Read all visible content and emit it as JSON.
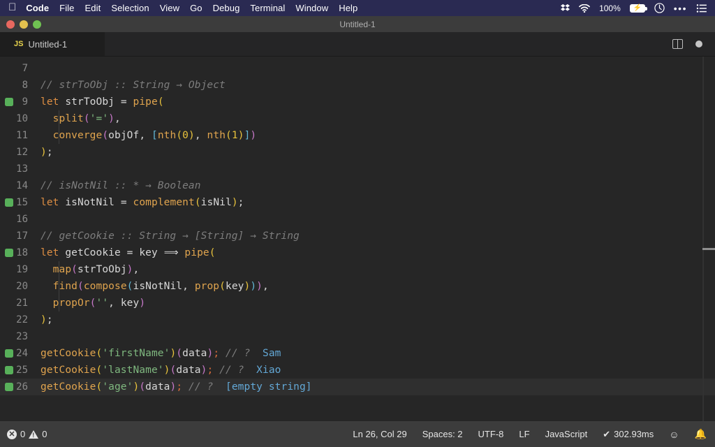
{
  "menubar": {
    "apple_icon": "apple-logo",
    "items": [
      {
        "label": "Code",
        "bold": true
      },
      {
        "label": "File",
        "bold": false
      },
      {
        "label": "Edit",
        "bold": false
      },
      {
        "label": "Selection",
        "bold": false
      },
      {
        "label": "View",
        "bold": false
      },
      {
        "label": "Go",
        "bold": false
      },
      {
        "label": "Debug",
        "bold": false
      },
      {
        "label": "Terminal",
        "bold": false
      },
      {
        "label": "Window",
        "bold": false
      },
      {
        "label": "Help",
        "bold": false
      }
    ],
    "status": {
      "dropbox_icon": "dropbox-icon",
      "wifi_icon": "wifi-icon",
      "battery_percent": "100%",
      "battery_icon": "battery-charging-icon",
      "clock_icon": "clock-icon",
      "more_icon": "ellipsis-icon",
      "list_icon": "control-center-icon"
    },
    "background": "#2a2a52"
  },
  "window": {
    "title": "Untitled-1",
    "traffic_lights": [
      "close",
      "minimize",
      "zoom"
    ],
    "colors": {
      "close": "#e8685f",
      "minimize": "#e3c14e",
      "zoom": "#70c352"
    }
  },
  "tabbar": {
    "tab": {
      "language_badge": "JS",
      "name": "Untitled-1"
    },
    "actions": {
      "split_editor_icon": "split-editor-icon",
      "unsaved_dot": "unsaved-indicator"
    }
  },
  "editor": {
    "first_visible_line": 7,
    "current_line": 26,
    "lines": [
      {
        "num": 7,
        "breakpoint": false,
        "indent": false,
        "tokens": []
      },
      {
        "num": 8,
        "breakpoint": false,
        "indent": false,
        "tokens": [
          {
            "t": "// strToObj :: String → Object",
            "c": "c-comment"
          }
        ]
      },
      {
        "num": 9,
        "breakpoint": true,
        "indent": false,
        "tokens": [
          {
            "t": "let",
            "c": "c-kw"
          },
          {
            "t": " ",
            "c": "c-plain"
          },
          {
            "t": "strToObj",
            "c": "c-var"
          },
          {
            "t": " ",
            "c": "c-plain"
          },
          {
            "t": "=",
            "c": "c-op"
          },
          {
            "t": " ",
            "c": "c-plain"
          },
          {
            "t": "pipe",
            "c": "c-fn"
          },
          {
            "t": "(",
            "c": "c-paren1"
          }
        ]
      },
      {
        "num": 10,
        "breakpoint": false,
        "indent": true,
        "tokens": [
          {
            "t": "  ",
            "c": "c-plain"
          },
          {
            "t": "split",
            "c": "c-fn"
          },
          {
            "t": "(",
            "c": "c-paren2"
          },
          {
            "t": "'='",
            "c": "c-str"
          },
          {
            "t": ")",
            "c": "c-paren2"
          },
          {
            "t": ",",
            "c": "c-plain"
          }
        ]
      },
      {
        "num": 11,
        "breakpoint": false,
        "indent": true,
        "tokens": [
          {
            "t": "  ",
            "c": "c-plain"
          },
          {
            "t": "converge",
            "c": "c-fn"
          },
          {
            "t": "(",
            "c": "c-paren2"
          },
          {
            "t": "objOf",
            "c": "c-var"
          },
          {
            "t": ", ",
            "c": "c-plain"
          },
          {
            "t": "[",
            "c": "c-paren3"
          },
          {
            "t": "nth",
            "c": "c-fn"
          },
          {
            "t": "(",
            "c": "c-paren1"
          },
          {
            "t": "0",
            "c": "c-num"
          },
          {
            "t": ")",
            "c": "c-paren1"
          },
          {
            "t": ", ",
            "c": "c-plain"
          },
          {
            "t": "nth",
            "c": "c-fn"
          },
          {
            "t": "(",
            "c": "c-paren1"
          },
          {
            "t": "1",
            "c": "c-num"
          },
          {
            "t": ")",
            "c": "c-paren1"
          },
          {
            "t": "]",
            "c": "c-paren3"
          },
          {
            "t": ")",
            "c": "c-paren2"
          }
        ]
      },
      {
        "num": 12,
        "breakpoint": false,
        "indent": false,
        "tokens": [
          {
            "t": ")",
            "c": "c-paren1"
          },
          {
            "t": ";",
            "c": "c-plain"
          }
        ]
      },
      {
        "num": 13,
        "breakpoint": false,
        "indent": false,
        "tokens": []
      },
      {
        "num": 14,
        "breakpoint": false,
        "indent": false,
        "tokens": [
          {
            "t": "// isNotNil :: * → Boolean",
            "c": "c-comment"
          }
        ]
      },
      {
        "num": 15,
        "breakpoint": true,
        "indent": false,
        "tokens": [
          {
            "t": "let",
            "c": "c-kw"
          },
          {
            "t": " ",
            "c": "c-plain"
          },
          {
            "t": "isNotNil",
            "c": "c-var"
          },
          {
            "t": " ",
            "c": "c-plain"
          },
          {
            "t": "=",
            "c": "c-op"
          },
          {
            "t": " ",
            "c": "c-plain"
          },
          {
            "t": "complement",
            "c": "c-fn"
          },
          {
            "t": "(",
            "c": "c-paren1"
          },
          {
            "t": "isNil",
            "c": "c-var"
          },
          {
            "t": ")",
            "c": "c-paren1"
          },
          {
            "t": ";",
            "c": "c-plain"
          }
        ]
      },
      {
        "num": 16,
        "breakpoint": false,
        "indent": false,
        "tokens": []
      },
      {
        "num": 17,
        "breakpoint": false,
        "indent": false,
        "tokens": [
          {
            "t": "// getCookie :: String → [String] → String",
            "c": "c-comment"
          }
        ]
      },
      {
        "num": 18,
        "breakpoint": true,
        "indent": false,
        "tokens": [
          {
            "t": "let",
            "c": "c-kw"
          },
          {
            "t": " ",
            "c": "c-plain"
          },
          {
            "t": "getCookie",
            "c": "c-var"
          },
          {
            "t": " ",
            "c": "c-plain"
          },
          {
            "t": "=",
            "c": "c-op"
          },
          {
            "t": " ",
            "c": "c-plain"
          },
          {
            "t": "key",
            "c": "c-var"
          },
          {
            "t": " ",
            "c": "c-plain"
          },
          {
            "t": "⟹",
            "c": "c-op"
          },
          {
            "t": " ",
            "c": "c-plain"
          },
          {
            "t": "pipe",
            "c": "c-fn"
          },
          {
            "t": "(",
            "c": "c-paren1"
          }
        ]
      },
      {
        "num": 19,
        "breakpoint": false,
        "indent": true,
        "tokens": [
          {
            "t": "  ",
            "c": "c-plain"
          },
          {
            "t": "map",
            "c": "c-fn"
          },
          {
            "t": "(",
            "c": "c-paren2"
          },
          {
            "t": "strToObj",
            "c": "c-var"
          },
          {
            "t": ")",
            "c": "c-paren2"
          },
          {
            "t": ",",
            "c": "c-plain"
          }
        ]
      },
      {
        "num": 20,
        "breakpoint": false,
        "indent": true,
        "tokens": [
          {
            "t": "  ",
            "c": "c-plain"
          },
          {
            "t": "find",
            "c": "c-fn"
          },
          {
            "t": "(",
            "c": "c-paren2"
          },
          {
            "t": "compose",
            "c": "c-fn"
          },
          {
            "t": "(",
            "c": "c-paren3"
          },
          {
            "t": "isNotNil",
            "c": "c-var"
          },
          {
            "t": ", ",
            "c": "c-plain"
          },
          {
            "t": "prop",
            "c": "c-fn"
          },
          {
            "t": "(",
            "c": "c-paren1"
          },
          {
            "t": "key",
            "c": "c-var"
          },
          {
            "t": ")",
            "c": "c-paren1"
          },
          {
            "t": ")",
            "c": "c-paren3"
          },
          {
            "t": ")",
            "c": "c-paren2"
          },
          {
            "t": ",",
            "c": "c-plain"
          }
        ]
      },
      {
        "num": 21,
        "breakpoint": false,
        "indent": true,
        "tokens": [
          {
            "t": "  ",
            "c": "c-plain"
          },
          {
            "t": "propOr",
            "c": "c-fn"
          },
          {
            "t": "(",
            "c": "c-paren2"
          },
          {
            "t": "''",
            "c": "c-str"
          },
          {
            "t": ", ",
            "c": "c-plain"
          },
          {
            "t": "key",
            "c": "c-var"
          },
          {
            "t": ")",
            "c": "c-paren2"
          }
        ]
      },
      {
        "num": 22,
        "breakpoint": false,
        "indent": false,
        "tokens": [
          {
            "t": ")",
            "c": "c-paren1"
          },
          {
            "t": ";",
            "c": "c-plain"
          }
        ]
      },
      {
        "num": 23,
        "breakpoint": false,
        "indent": false,
        "tokens": []
      },
      {
        "num": 24,
        "breakpoint": true,
        "indent": false,
        "tokens": [
          {
            "t": "getCookie",
            "c": "c-fn"
          },
          {
            "t": "(",
            "c": "c-paren1"
          },
          {
            "t": "'firstName'",
            "c": "c-str"
          },
          {
            "t": ")",
            "c": "c-paren1"
          },
          {
            "t": "(",
            "c": "c-paren2"
          },
          {
            "t": "data",
            "c": "c-var"
          },
          {
            "t": ")",
            "c": "c-paren2"
          },
          {
            "t": ";",
            "c": "c-semi"
          },
          {
            "t": " ",
            "c": "c-plain"
          },
          {
            "t": "// ?",
            "c": "c-comment"
          },
          {
            "t": "  ",
            "c": "c-plain"
          },
          {
            "t": "Sam",
            "c": "c-out"
          }
        ]
      },
      {
        "num": 25,
        "breakpoint": true,
        "indent": false,
        "tokens": [
          {
            "t": "getCookie",
            "c": "c-fn"
          },
          {
            "t": "(",
            "c": "c-paren1"
          },
          {
            "t": "'lastName'",
            "c": "c-str"
          },
          {
            "t": ")",
            "c": "c-paren1"
          },
          {
            "t": "(",
            "c": "c-paren2"
          },
          {
            "t": "data",
            "c": "c-var"
          },
          {
            "t": ")",
            "c": "c-paren2"
          },
          {
            "t": ";",
            "c": "c-semi"
          },
          {
            "t": " ",
            "c": "c-plain"
          },
          {
            "t": "// ?",
            "c": "c-comment"
          },
          {
            "t": "  ",
            "c": "c-plain"
          },
          {
            "t": "Xiao",
            "c": "c-out"
          }
        ]
      },
      {
        "num": 26,
        "breakpoint": true,
        "indent": false,
        "tokens": [
          {
            "t": "getCookie",
            "c": "c-fn"
          },
          {
            "t": "(",
            "c": "c-paren1"
          },
          {
            "t": "'age'",
            "c": "c-str"
          },
          {
            "t": ")",
            "c": "c-paren1"
          },
          {
            "t": "(",
            "c": "c-paren2"
          },
          {
            "t": "data",
            "c": "c-var"
          },
          {
            "t": ")",
            "c": "c-paren2"
          },
          {
            "t": ";",
            "c": "c-semi"
          },
          {
            "t": " ",
            "c": "c-plain"
          },
          {
            "t": "// ?",
            "c": "c-comment"
          },
          {
            "t": "  ",
            "c": "c-plain"
          },
          {
            "t": "[empty string]",
            "c": "c-out"
          }
        ]
      }
    ]
  },
  "statusbar": {
    "errors": "0",
    "warnings": "0",
    "cursor": "Ln 26, Col 29",
    "indentation": "Spaces: 2",
    "encoding": "UTF-8",
    "eol": "LF",
    "language": "JavaScript",
    "check_mark": "✔",
    "timing": "302.93ms",
    "feedback_icon": "smiley-icon",
    "bell_icon": "bell-icon"
  }
}
